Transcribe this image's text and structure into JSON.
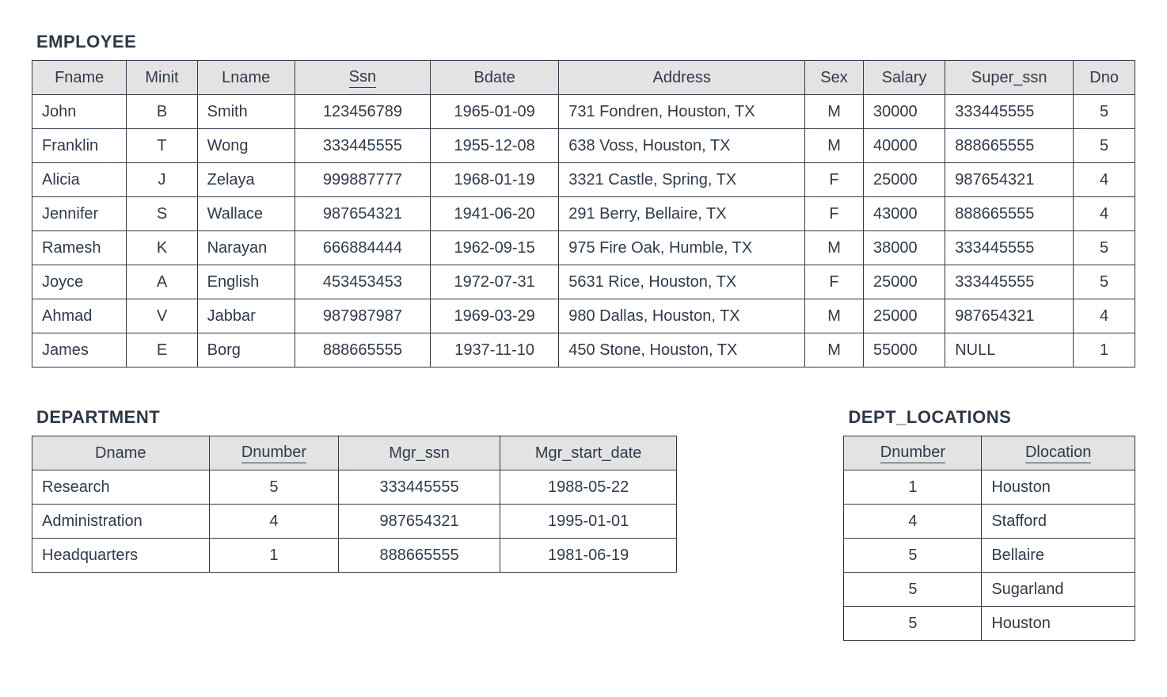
{
  "employee": {
    "title": "EMPLOYEE",
    "columns": [
      {
        "label": "Fname",
        "underline": false,
        "align": "left"
      },
      {
        "label": "Minit",
        "underline": false,
        "align": "center"
      },
      {
        "label": "Lname",
        "underline": false,
        "align": "left"
      },
      {
        "label": "Ssn",
        "underline": true,
        "align": "center"
      },
      {
        "label": "Bdate",
        "underline": false,
        "align": "center"
      },
      {
        "label": "Address",
        "underline": false,
        "align": "left"
      },
      {
        "label": "Sex",
        "underline": false,
        "align": "center"
      },
      {
        "label": "Salary",
        "underline": false,
        "align": "left"
      },
      {
        "label": "Super_ssn",
        "underline": false,
        "align": "left"
      },
      {
        "label": "Dno",
        "underline": false,
        "align": "center"
      }
    ],
    "rows": [
      [
        "John",
        "B",
        "Smith",
        "123456789",
        "1965-01-09",
        "731 Fondren, Houston, TX",
        "M",
        "30000",
        "333445555",
        "5"
      ],
      [
        "Franklin",
        "T",
        "Wong",
        "333445555",
        "1955-12-08",
        "638 Voss, Houston, TX",
        "M",
        "40000",
        "888665555",
        "5"
      ],
      [
        "Alicia",
        "J",
        "Zelaya",
        "999887777",
        "1968-01-19",
        "3321 Castle, Spring, TX",
        "F",
        "25000",
        "987654321",
        "4"
      ],
      [
        "Jennifer",
        "S",
        "Wallace",
        "987654321",
        "1941-06-20",
        "291 Berry, Bellaire, TX",
        "F",
        "43000",
        "888665555",
        "4"
      ],
      [
        "Ramesh",
        "K",
        "Narayan",
        "666884444",
        "1962-09-15",
        "975 Fire Oak, Humble, TX",
        "M",
        "38000",
        "333445555",
        "5"
      ],
      [
        "Joyce",
        "A",
        "English",
        "453453453",
        "1972-07-31",
        "5631 Rice, Houston, TX",
        "F",
        "25000",
        "333445555",
        "5"
      ],
      [
        "Ahmad",
        "V",
        "Jabbar",
        "987987987",
        "1969-03-29",
        "980 Dallas, Houston, TX",
        "M",
        "25000",
        "987654321",
        "4"
      ],
      [
        "James",
        "E",
        "Borg",
        "888665555",
        "1937-11-10",
        "450 Stone, Houston, TX",
        "M",
        "55000",
        "NULL",
        "1"
      ]
    ]
  },
  "department": {
    "title": "DEPARTMENT",
    "columns": [
      {
        "label": "Dname",
        "underline": false,
        "align": "left"
      },
      {
        "label": "Dnumber",
        "underline": true,
        "align": "center"
      },
      {
        "label": "Mgr_ssn",
        "underline": false,
        "align": "center"
      },
      {
        "label": "Mgr_start_date",
        "underline": false,
        "align": "center"
      }
    ],
    "rows": [
      [
        "Research",
        "5",
        "333445555",
        "1988-05-22"
      ],
      [
        "Administration",
        "4",
        "987654321",
        "1995-01-01"
      ],
      [
        "Headquarters",
        "1",
        "888665555",
        "1981-06-19"
      ]
    ]
  },
  "dept_locations": {
    "title": "DEPT_LOCATIONS",
    "columns": [
      {
        "label": "Dnumber",
        "underline": true,
        "align": "center"
      },
      {
        "label": "Dlocation",
        "underline": true,
        "align": "left"
      }
    ],
    "rows": [
      [
        "1",
        "Houston"
      ],
      [
        "4",
        "Stafford"
      ],
      [
        "5",
        "Bellaire"
      ],
      [
        "5",
        "Sugarland"
      ],
      [
        "5",
        "Houston"
      ]
    ]
  }
}
